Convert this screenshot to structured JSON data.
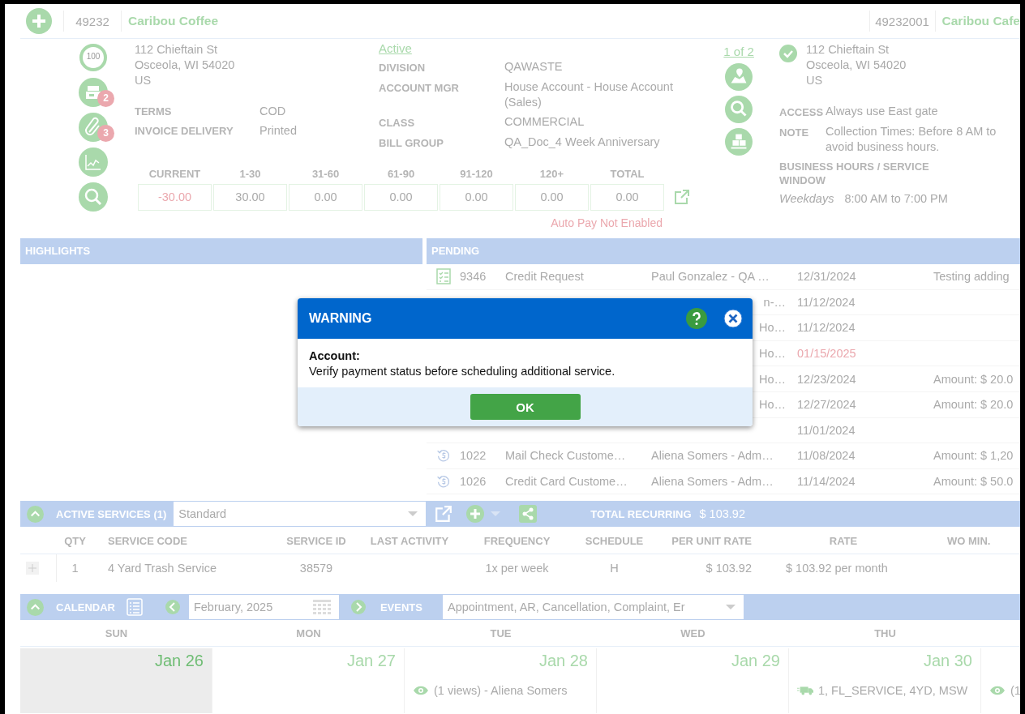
{
  "header": {
    "account_id": "49232",
    "account_name": "Caribou Coffee",
    "site_id": "49232001",
    "site_name": "Caribou Cafe"
  },
  "side_icons": [
    {
      "kind": "score",
      "text": "100"
    },
    {
      "kind": "billing",
      "badge": "2"
    },
    {
      "kind": "attachment",
      "badge": "3"
    },
    {
      "kind": "chart"
    },
    {
      "kind": "lookup"
    }
  ],
  "address": [
    "112 Chieftain St",
    "Osceola, WI 54020",
    "US"
  ],
  "terms": [
    {
      "label": "TERMS",
      "value": "COD"
    },
    {
      "label": "INVOICE DELIVERY",
      "value": "Printed"
    }
  ],
  "status_link": "Active",
  "details": [
    {
      "label": "DIVISION",
      "value": "QAWASTE"
    },
    {
      "label": "ACCOUNT MGR",
      "value": "House Account - House Account (Sales)"
    },
    {
      "label": "CLASS",
      "value": "COMMERCIAL"
    },
    {
      "label": "BILL GROUP",
      "value": "QA_Doc_4 Week Anniversary"
    }
  ],
  "aging": [
    {
      "label": "CURRENT",
      "value": "-30.00",
      "negative": true
    },
    {
      "label": "1-30",
      "value": "30.00",
      "negative": false
    },
    {
      "label": "31-60",
      "value": "0.00",
      "negative": false
    },
    {
      "label": "61-90",
      "value": "0.00",
      "negative": false
    },
    {
      "label": "91-120",
      "value": "0.00",
      "negative": false
    },
    {
      "label": "120+",
      "value": "0.00",
      "negative": false
    },
    {
      "label": "TOTAL",
      "value": "0.00",
      "negative": false
    }
  ],
  "auto_pay": "Auto Pay Not Enabled",
  "site": {
    "pager": "1 of 2",
    "address": [
      "112 Chieftain St",
      "Osceola, WI 54020",
      "US"
    ],
    "info": [
      {
        "label": "ACCESS",
        "value": "Always use East gate"
      },
      {
        "label": "NOTE",
        "value": "Collection Times: Before 8 AM to avoid business hours."
      }
    ],
    "hours_label": "BUSINESS HOURS / SERVICE WINDOW",
    "hours_day": "Weekdays",
    "hours_time": "8:00 AM to 7:00 PM"
  },
  "highlights": {
    "title": "HIGHLIGHTS"
  },
  "pending": {
    "title": "PENDING",
    "rows": [
      {
        "kind": "checklist",
        "id": "9346",
        "type": "Credit Request",
        "author": "Paul Gonzalez - QA …",
        "date": "12/31/2024",
        "overdue": false,
        "note": "Testing adding"
      },
      {
        "author_tail": "n-…",
        "date": "11/12/2024",
        "overdue": false
      },
      {
        "author_tail": "Ho…",
        "date": "11/12/2024",
        "overdue": false
      },
      {
        "author_tail": "Ho…",
        "date": "01/15/2025",
        "overdue": true
      },
      {
        "author_tail": "Ho…",
        "date": "12/23/2024",
        "overdue": false,
        "note": "Amount: $ 20.0"
      },
      {
        "author_tail": "Ho…",
        "date": "12/27/2024",
        "overdue": false,
        "note": "Amount: $ 20.0"
      },
      {
        "date": "11/01/2024",
        "overdue": false
      },
      {
        "kind": "refund",
        "id": "1022",
        "type": "Mail Check Custome…",
        "author": "Aliena Somers - Adm…",
        "date": "11/08/2024",
        "overdue": false,
        "note": "Amount: $ 1,20"
      },
      {
        "kind": "refund",
        "id": "1026",
        "type": "Credit Card Custome…",
        "author": "Aliena Somers - Adm…",
        "date": "11/14/2024",
        "overdue": false,
        "note": "Amount: $ 50.0"
      }
    ]
  },
  "services": {
    "title": "ACTIVE SERVICES (1)",
    "expanded": true,
    "view": "Standard",
    "total_label": "TOTAL RECURRING",
    "total": "$ 103.92",
    "columns": [
      "QTY",
      "SERVICE CODE",
      "SERVICE ID",
      "LAST ACTIVITY",
      "FREQUENCY",
      "SCHEDULE",
      "PER UNIT RATE",
      "RATE",
      "WO MIN."
    ],
    "rows": [
      {
        "cells": [
          "1",
          "4 Yard Trash Service",
          "38579",
          "",
          "1x per week",
          "H",
          "$ 103.92",
          "$ 103.92 per month",
          ""
        ]
      }
    ]
  },
  "calendar": {
    "title": "CALENDAR",
    "expanded": true,
    "month": "February, 2025",
    "events_label": "EVENTS",
    "events_filter": "Appointment, AR, Cancellation, Complaint, Er",
    "days": [
      "SUN",
      "MON",
      "TUE",
      "WED",
      "THU"
    ],
    "cells": [
      {
        "date": "Jan 26",
        "outside_month": true
      },
      {
        "date": "Jan 27",
        "outside_month": false
      },
      {
        "date": "Jan 28",
        "outside_month": false,
        "events": [
          {
            "kind": "view",
            "text": "(1 views) - Aliena Somers"
          }
        ]
      },
      {
        "date": "Jan 29",
        "outside_month": false
      },
      {
        "date": "Jan 30",
        "outside_month": false,
        "events": [
          {
            "kind": "route",
            "text": "1, FL_SERVICE, 4YD, MSW"
          }
        ]
      },
      {
        "outside_month": false,
        "events": [
          {
            "kind": "view",
            "text": "(1"
          }
        ]
      }
    ]
  },
  "dialog": {
    "title": "WARNING",
    "heading": "Account:",
    "message": "Verify payment status before scheduling additional service.",
    "button": "OK"
  }
}
